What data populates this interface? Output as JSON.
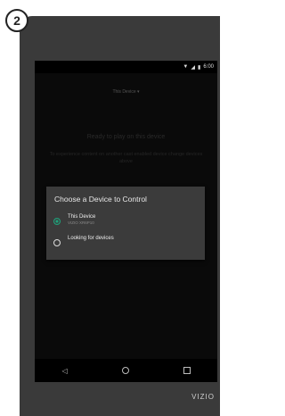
{
  "step": {
    "number": "2"
  },
  "status_bar": {
    "time": "6:00",
    "wifi_icon": "wifi-icon",
    "signal_icon": "signal-icon",
    "battery_icon": "battery-icon"
  },
  "app": {
    "device_selector": "This Device",
    "heading": "Ready to play on this device",
    "subtext": "To experience content on another cast enabled device change devices above"
  },
  "dialog": {
    "title": "Choose a Device to Control",
    "options": [
      {
        "label": "This Device",
        "sublabel": "VIZIO XR6P10",
        "selected": true
      },
      {
        "label": "Looking for devices",
        "selected": false
      }
    ]
  },
  "nav": {
    "back_icon": "back-icon",
    "home_icon": "home-icon",
    "recents_icon": "recents-icon"
  },
  "brand": {
    "name": "VIZIO"
  },
  "colors": {
    "accent": "#1fa07a",
    "dialog_bg": "#3b3b3b",
    "bezel": "#3a3a3a"
  }
}
